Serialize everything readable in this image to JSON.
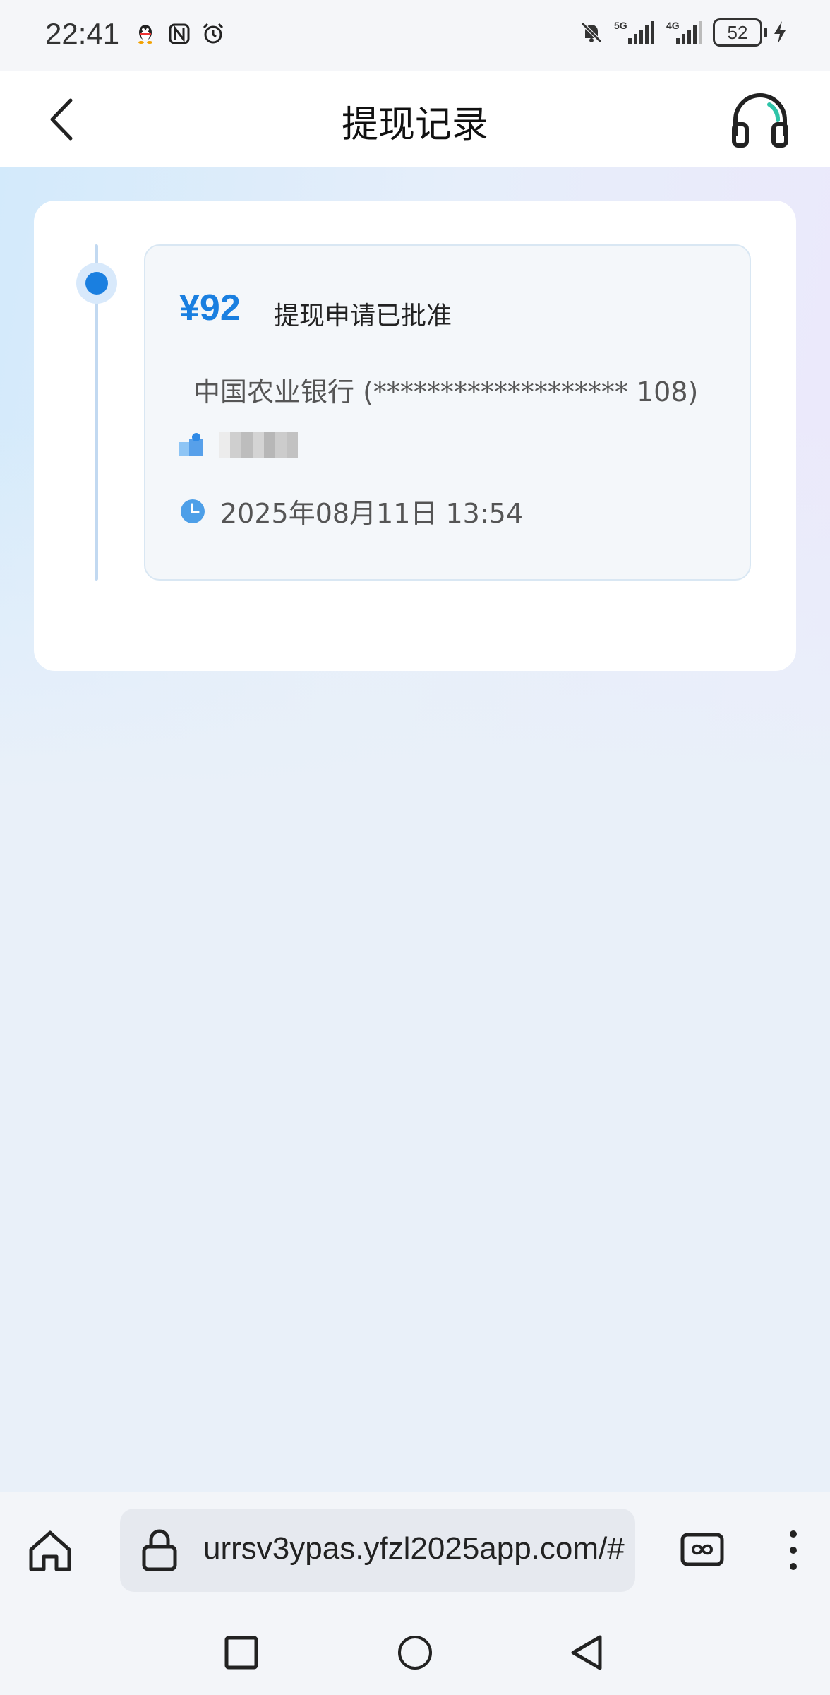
{
  "status_bar": {
    "time": "22:41",
    "battery": "52",
    "icons": [
      "qq-icon",
      "nfc-icon",
      "alarm-icon",
      "mute-icon",
      "signal-5g-icon",
      "signal-4g-icon",
      "charging-icon"
    ]
  },
  "header": {
    "title": "提现记录",
    "back_icon": "chevron-left-icon",
    "support_icon": "headset-icon"
  },
  "records": [
    {
      "amount": "¥92",
      "status": "提现申请已批准",
      "bank": "中国农业银行 (******************* 108)",
      "user_icon": "user-icon",
      "time": "2025年08月11日 13:54"
    }
  ],
  "browser": {
    "url": "urrsv3ypas.yfzl2025app.com/#",
    "home_icon": "home-icon",
    "lock_icon": "lock-icon",
    "tabs_icon": "tabs-icon",
    "menu_icon": "more-vert-icon"
  },
  "colors": {
    "accent": "#1a7fe0",
    "page_bg": "#e9f0f9"
  }
}
